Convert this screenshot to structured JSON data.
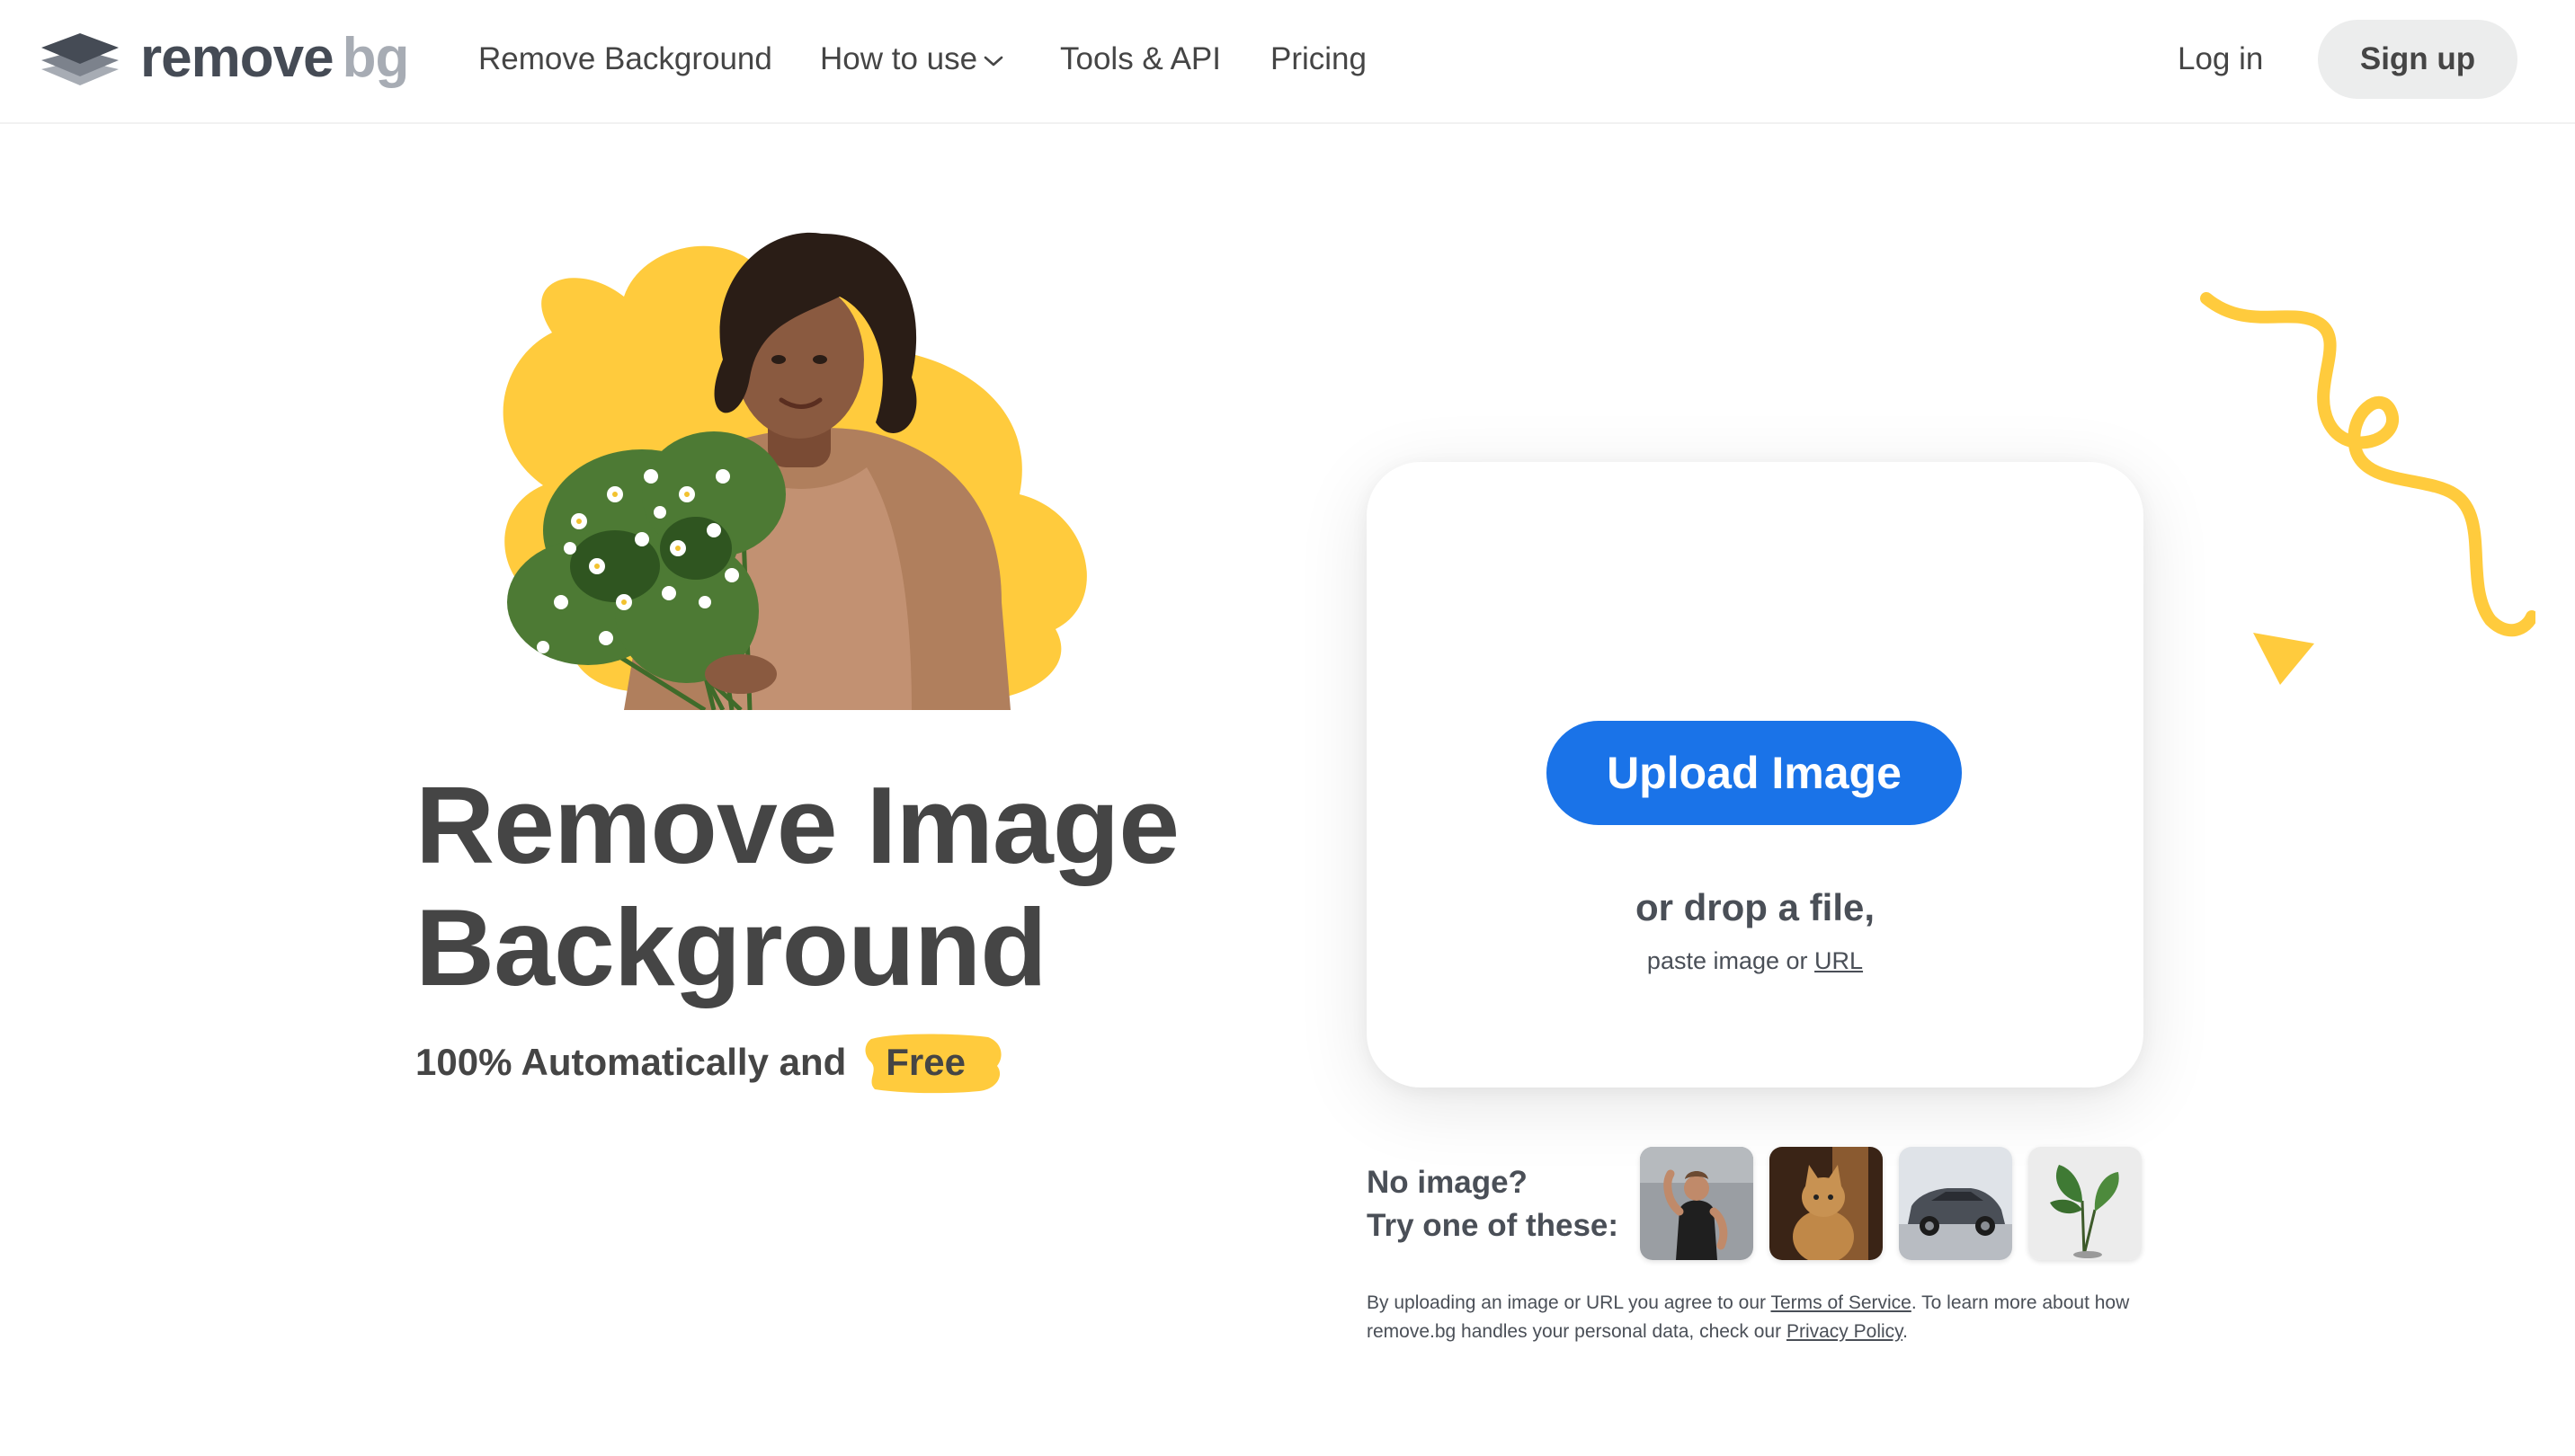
{
  "nav": {
    "logo_word1": "remove",
    "logo_word2": "bg",
    "links": [
      {
        "label": "Remove Background"
      },
      {
        "label": "How to use"
      },
      {
        "label": "Tools & API"
      },
      {
        "label": "Pricing"
      }
    ],
    "login": "Log in",
    "signup": "Sign up"
  },
  "hero": {
    "title_line1": "Remove Image",
    "title_line2": "Background",
    "subtitle_prefix": "100% Automatically and",
    "subtitle_highlight": "Free"
  },
  "upload": {
    "button": "Upload Image",
    "drop": "or drop a file,",
    "paste_prefix": "paste image or",
    "paste_link": "URL"
  },
  "samples": {
    "line1": "No image?",
    "line2": "Try one of these:"
  },
  "legal": {
    "p1": "By uploading an image or URL you agree to our",
    "tos": "Terms of Service",
    "p2": ". To learn more about how remove.bg handles your personal data, check our",
    "privacy": "Privacy Policy",
    "p3": "."
  },
  "colors": {
    "primary": "#1a73e8",
    "accent_yellow": "#ffcb3d",
    "text": "#454545"
  },
  "icons": [
    "logo-icon",
    "chevron-down-icon"
  ]
}
